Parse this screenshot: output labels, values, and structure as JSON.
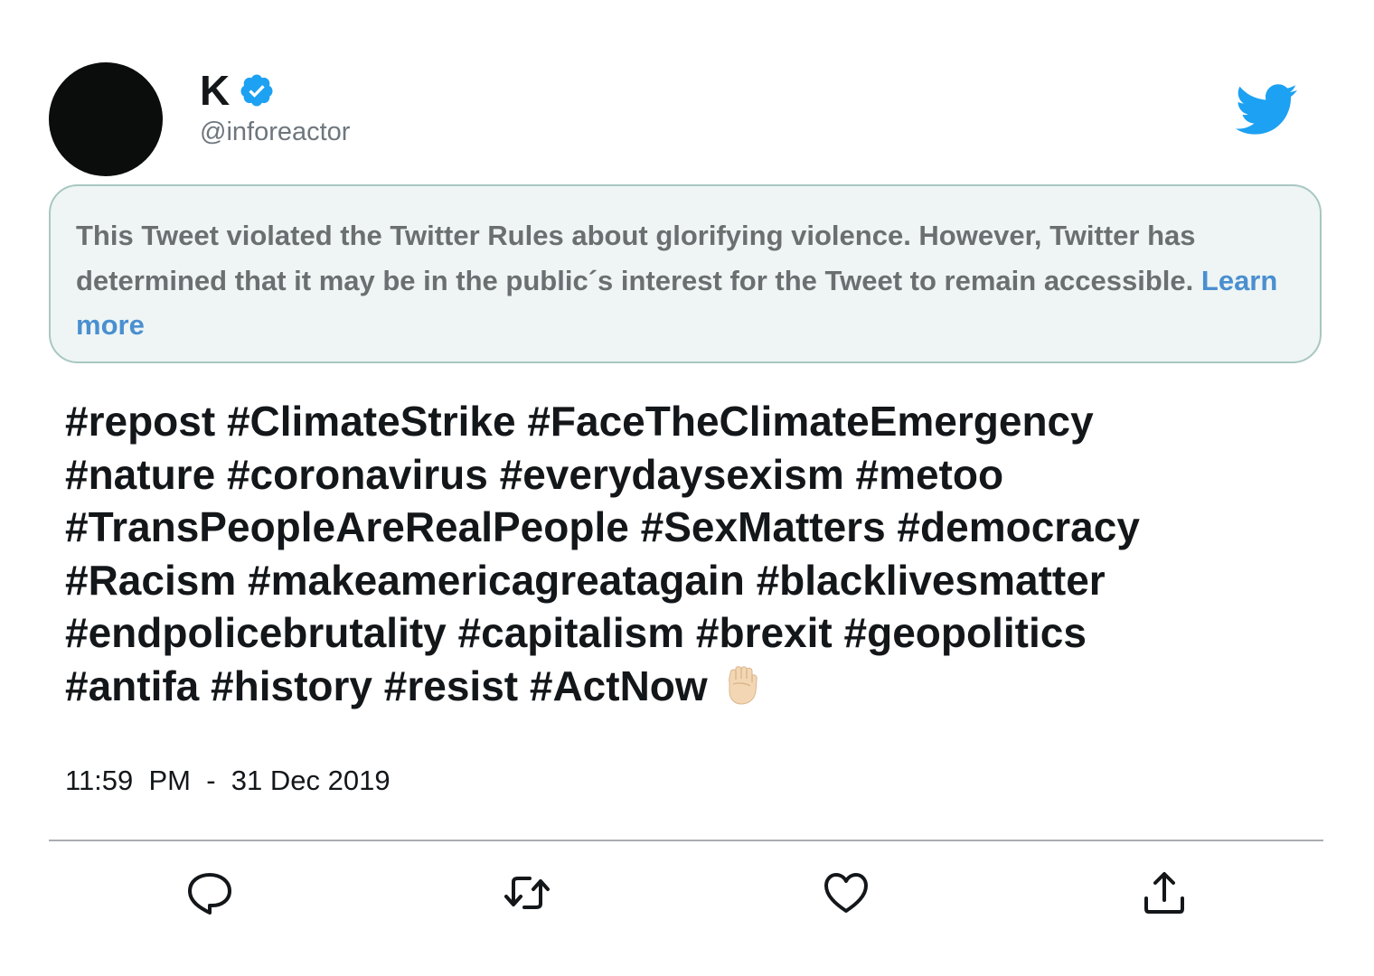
{
  "user": {
    "display_name": "K",
    "handle": "@inforeactor",
    "verified": true
  },
  "notice": {
    "text": "This Tweet violated the Twitter Rules about glorifying violence. However, Twitter has determined that it may be in the public´s interest for the Tweet to remain accessible. ",
    "link_label": "Learn more"
  },
  "tweet": {
    "lines": [
      "#repost #ClimateStrike #FaceTheClimateEmergency",
      "#nature #coronavirus #everydaysexism #metoo",
      "#TransPeopleAreRealPeople #SexMatters #democracy",
      "#Racism #makeamericagreatagain #blacklivesmatter",
      "#endpolicebrutality #capitalism #brexit #geopolitics",
      "#antifa #history #resist #ActNow"
    ],
    "trailing_emoji": "raised-fist-light-skin-tone"
  },
  "timestamp": "11:59  PM  -  31 Dec 2019",
  "actions": {
    "reply_icon": "speech-bubble",
    "retweet_icon": "retweet-arrows",
    "like_icon": "heart",
    "share_icon": "share-upload"
  },
  "colors": {
    "accent": "#1da1f2",
    "link": "#4a8fd0",
    "notice_bg": "#eef5f4",
    "notice_border": "#a8c7c2"
  }
}
